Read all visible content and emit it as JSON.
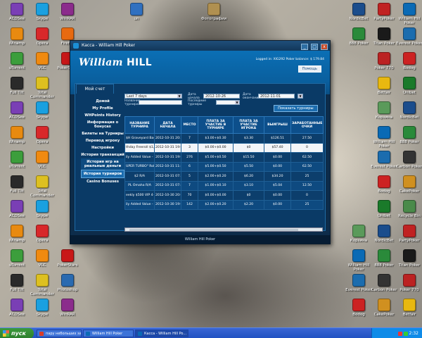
{
  "desktop_left": [
    {
      "label": "ACDSee",
      "color": "#7a3fb5"
    },
    {
      "label": "Skype",
      "color": "#1aa0e0"
    },
    {
      "label": "WinRAR",
      "color": "#8b2c8c"
    },
    {
      "label": "Winamp",
      "color": "#e88a10"
    },
    {
      "label": "Opera",
      "color": "#d8282a"
    },
    {
      "label": "Firefox",
      "color": "#e86a10"
    },
    {
      "label": "uTorrent",
      "color": "#3c9e3c"
    },
    {
      "label": "VLC",
      "color": "#f08a10"
    },
    {
      "label": "PokerStars",
      "color": "#c81818"
    },
    {
      "label": "Full Tilt",
      "color": "#2a2a2a"
    },
    {
      "label": "Total Commander",
      "color": "#ddc020"
    },
    {
      "label": "Photoshop",
      "color": "#2a6ab0"
    }
  ],
  "desktop_right": [
    {
      "label": "NordicBet",
      "color": "#1b4d8c"
    },
    {
      "label": "PartyPoker",
      "color": "#c02222"
    },
    {
      "label": "William Hill Poker",
      "color": "#0a6ab5"
    },
    {
      "label": "888 Poker",
      "color": "#2a8a3a"
    },
    {
      "label": "Titan Poker",
      "color": "#1a1a1a"
    },
    {
      "label": "Everest Poker",
      "color": "#1b6cae"
    },
    {
      "label": "Carbon Poker",
      "color": "#333"
    },
    {
      "label": "Poker 770",
      "color": "#b22"
    },
    {
      "label": "Bodog",
      "color": "#c22"
    },
    {
      "label": "CakePoker",
      "color": "#d09020"
    },
    {
      "label": "Betfair",
      "color": "#e8b810"
    },
    {
      "label": "Unibet",
      "color": "#1a7a2a"
    },
    {
      "label": "Recycle Bin",
      "color": "#4a8a4a"
    },
    {
      "label": "Корзина",
      "color": "#5a9a5a"
    }
  ],
  "desktop_top": [
    {
      "label": "un",
      "color": "#3070c0"
    },
    {
      "label": "Фотографии",
      "color": "#b09050"
    }
  ],
  "window": {
    "title": "Касса - William Hill Poker",
    "minimize": "_",
    "maximize": "□",
    "close": "x",
    "logo_script": "William",
    "logo_block": "HILL",
    "logged_in": "Logged in: XIG292     Poker balance: $ 179.84",
    "help_button": "Помощь",
    "tab_account": "Мой счет",
    "footer": "William Hill Poker"
  },
  "sidebar": [
    {
      "label": "Домой",
      "active": false,
      "name": "sidebar-item-home"
    },
    {
      "label": "My Profile",
      "active": false,
      "name": "sidebar-item-profile"
    },
    {
      "label": "WHPoints History",
      "active": false,
      "name": "sidebar-item-whpoints"
    },
    {
      "label": "Информация о бонусах",
      "active": false,
      "name": "sidebar-item-bonus-info"
    },
    {
      "label": "Билеты на Турниры",
      "active": false,
      "name": "sidebar-item-tickets"
    },
    {
      "label": "Перевод игроку",
      "active": false,
      "name": "sidebar-item-transfer"
    },
    {
      "label": "Настройки",
      "active": false,
      "name": "sidebar-item-settings"
    },
    {
      "label": "История транзакций",
      "active": false,
      "name": "sidebar-item-transactions"
    },
    {
      "label": "История игр на реальные деньги",
      "active": false,
      "name": "sidebar-item-game-history"
    },
    {
      "label": "История турниров",
      "active": true,
      "name": "sidebar-item-tournament-history"
    },
    {
      "label": "Casino Bonuses",
      "active": false,
      "name": "sidebar-item-casino-bonuses"
    }
  ],
  "filters": {
    "period_label": "",
    "period_value": "Last 7 days",
    "date_from_label": "Дата начала",
    "date_from": "2012-10-26",
    "date_to_label": "Дата окончания",
    "date_to": "2012-11-01",
    "name_label": "Название турнира",
    "recent_label": "Последние турниры",
    "show_button": "Показать турниры"
  },
  "table": {
    "headers": [
      "НАЗВАНИЕ ТУРНИРА",
      "ДАТА НАЧАЛА",
      "МЕСТО",
      "ПЛАТА ЗА УЧАСТИЕ В ТУРНИРЕ",
      "ПЛАТА ЗА УЧАСТИЕ ИГРОКА",
      "ВЫИГРЫШ",
      "ЗАРАБОТАННЫЕ ОЧКИ"
    ],
    "rows": [
      [
        "$H Graveyard Bash",
        "2012-10-31 20:37",
        "7",
        "$3.00+$0.30",
        "$3.30",
        "$126.51",
        "27.50"
      ],
      [
        "thday Freeroll $1,000",
        "2012-10-31 19:04",
        "3",
        "$0.00+$0.00",
        "$0",
        "$57.40",
        "0"
      ],
      [
        "ily Added Value - $1,000",
        "2012-10-31 19:04",
        "276",
        "$5.00+$0.50",
        "$15.50",
        "$0.00",
        "62.50"
      ],
      [
        "UPER TURBO\" Robin",
        "2012-10-31 11:45",
        "6",
        "$5.00+$0.50",
        "$5.50",
        "$0.00",
        "62.50"
      ],
      [
        "$2 R/A",
        "2012-10-31 07:38",
        "5",
        "$2.00+$0.20",
        "$6.20",
        "$34.20",
        "25"
      ],
      [
        "PL Omaha R/A",
        "2012-10-31 07:42",
        "7",
        "$1.00+$0.10",
        "$3.10",
        "$5.04",
        "12.50"
      ],
      [
        "eekly $500 VIP 4+",
        "2012-10-30 20:00",
        "70",
        "$0.00+$0.00",
        "$0",
        "$0.00",
        "0"
      ],
      [
        "ily Added Value - $500",
        "2012-10-30 19:00",
        "142",
        "$2.00+$0.20",
        "$2.20",
        "$0.00",
        "25"
      ]
    ],
    "selected_row": 1
  },
  "taskbar": {
    "start": "пуск",
    "tasks": [
      {
        "label": "пару небольших зам...",
        "color": "#d83c2a",
        "active": false
      },
      {
        "label": "William Hill Poker",
        "color": "#0a6ab5",
        "active": false
      },
      {
        "label": "Касса - William Hill Po...",
        "color": "#0a6ab5",
        "active": true
      }
    ],
    "clock": "2:32"
  }
}
